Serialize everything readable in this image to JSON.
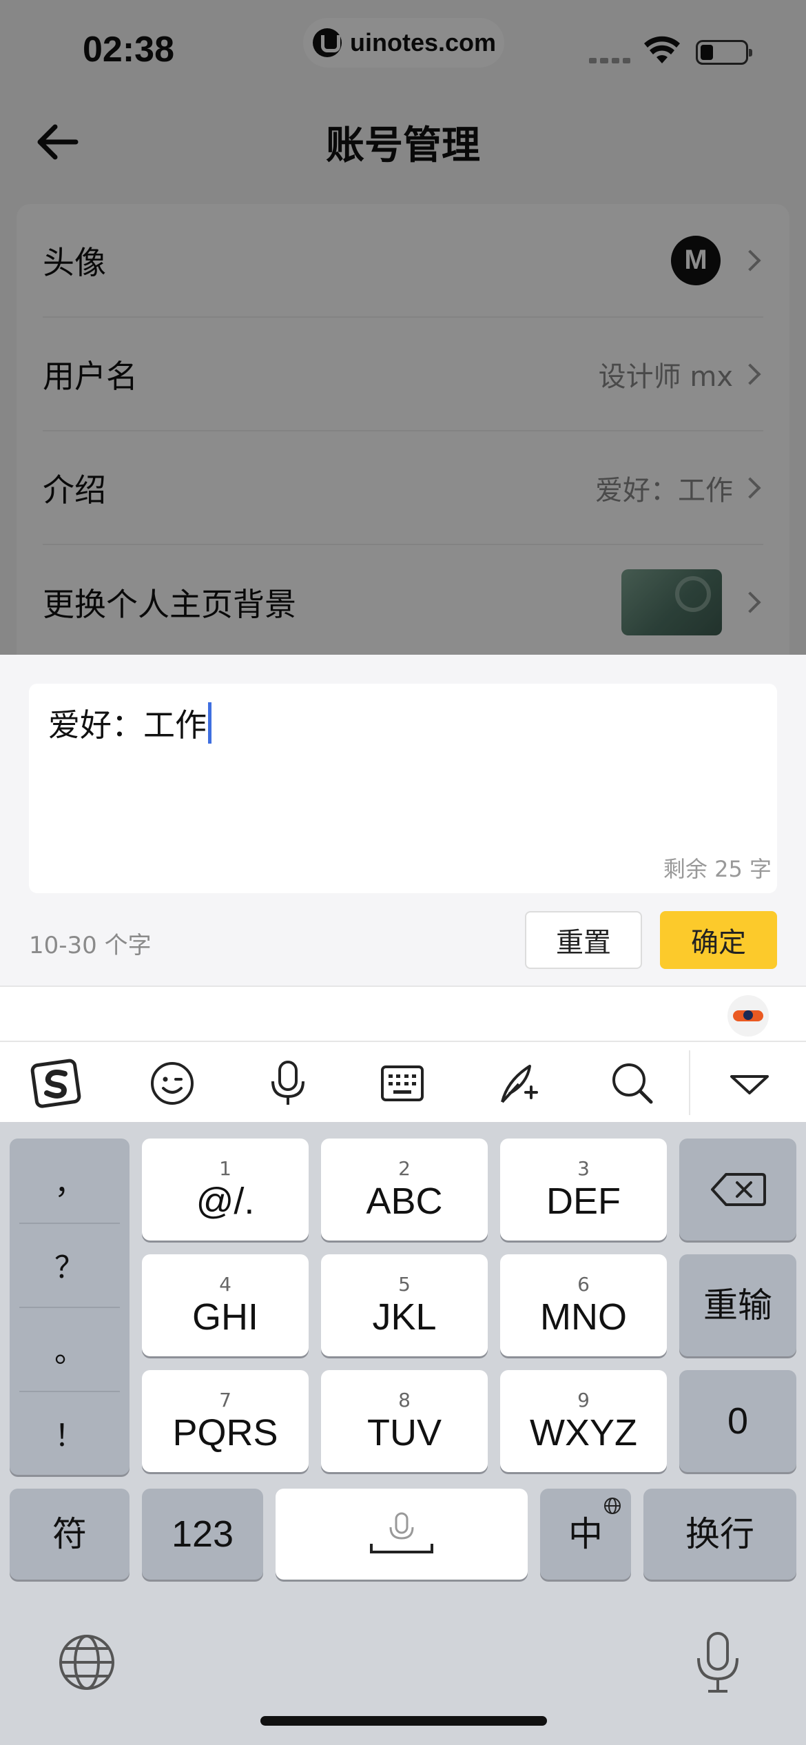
{
  "status_bar": {
    "time": "02:38",
    "url_pill": "uinotes.com"
  },
  "nav": {
    "title": "账号管理"
  },
  "settings": {
    "rows": [
      {
        "label": "头像",
        "value": ""
      },
      {
        "label": "用户名",
        "value": "设计师 mx"
      },
      {
        "label": "介绍",
        "value": "爱好：工作"
      },
      {
        "label": "更换个人主页背景",
        "value": ""
      }
    ],
    "avatar_text": "M"
  },
  "editor": {
    "text": "爱好：工作",
    "remaining": "剩余 25 字",
    "limit_hint": "10-30 个字",
    "reset_label": "重置",
    "confirm_label": "确定",
    "confirm_color": "#fcca2b",
    "caret_color": "#3f6fe0"
  },
  "keyboard": {
    "punct_keys": [
      "，",
      "？",
      "。",
      "！"
    ],
    "t9_keys": [
      {
        "num": "1",
        "label": "@/."
      },
      {
        "num": "2",
        "label": "ABC"
      },
      {
        "num": "3",
        "label": "DEF"
      },
      {
        "num": "4",
        "label": "GHI"
      },
      {
        "num": "5",
        "label": "JKL"
      },
      {
        "num": "6",
        "label": "MNO"
      },
      {
        "num": "7",
        "label": "PQRS"
      },
      {
        "num": "8",
        "label": "TUV"
      },
      {
        "num": "9",
        "label": "WXYZ"
      }
    ],
    "retype": "重输",
    "zero": "0",
    "symbols": "符",
    "numbers": "123",
    "lang": "中",
    "enter": "换行"
  }
}
